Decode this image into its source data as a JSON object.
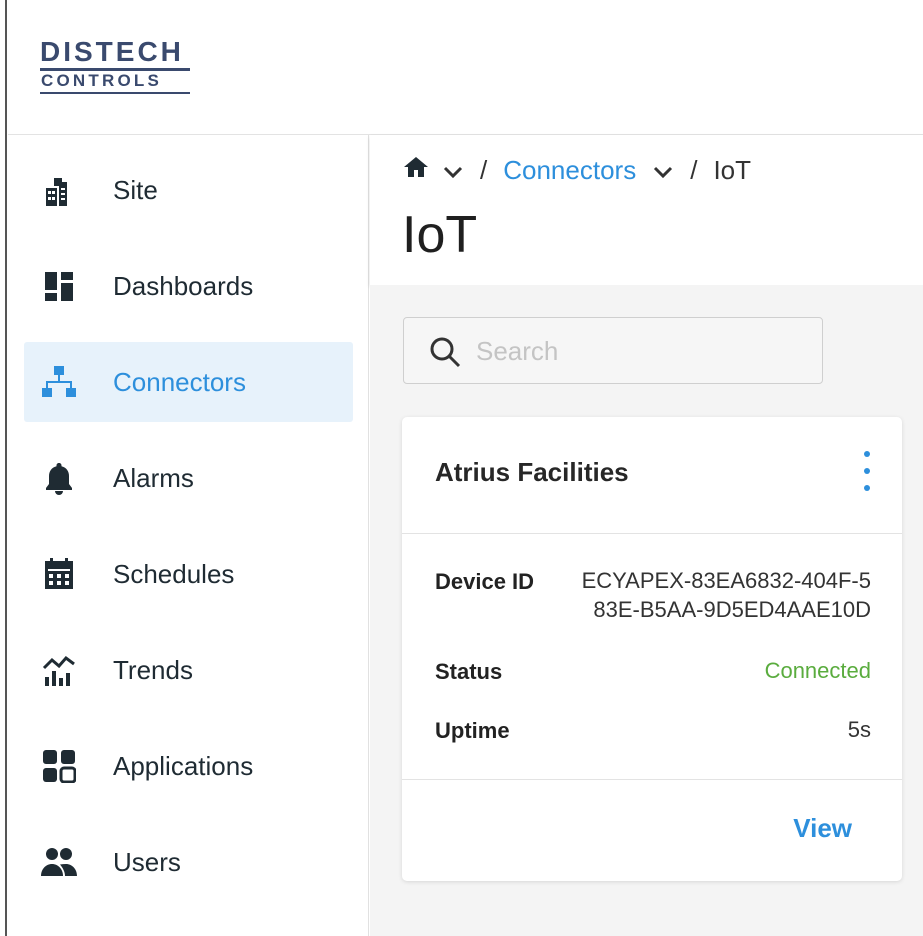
{
  "brand": {
    "line1": "DISTECH",
    "line2": "CONTROLS"
  },
  "sidebar": {
    "items": [
      {
        "label": "Site",
        "icon": "building-icon"
      },
      {
        "label": "Dashboards",
        "icon": "dashboard-icon"
      },
      {
        "label": "Connectors",
        "icon": "network-icon",
        "active": true
      },
      {
        "label": "Alarms",
        "icon": "bell-icon"
      },
      {
        "label": "Schedules",
        "icon": "calendar-icon"
      },
      {
        "label": "Trends",
        "icon": "trend-chart-icon"
      },
      {
        "label": "Applications",
        "icon": "apps-grid-icon"
      },
      {
        "label": "Users",
        "icon": "users-icon"
      }
    ]
  },
  "breadcrumb": {
    "home_icon": "home-icon",
    "middle": "Connectors",
    "current": "IoT",
    "separator": "/"
  },
  "page": {
    "title": "IoT"
  },
  "search": {
    "placeholder": "Search",
    "value": ""
  },
  "card": {
    "title": "Atrius Facilities",
    "rows": [
      {
        "label": "Device ID",
        "value_line1": "ECYAPEX-83EA6832-404F-5",
        "value_line2": "83E-B5AA-9D5ED4AAE10D"
      },
      {
        "label": "Status",
        "value": "Connected"
      },
      {
        "label": "Uptime",
        "value": "5s"
      }
    ],
    "action": "View"
  },
  "colors": {
    "accent": "#2d8fdc",
    "connected": "#5aac3e",
    "active_bg": "#e7f2fb",
    "brand": "#3a4a6e"
  }
}
